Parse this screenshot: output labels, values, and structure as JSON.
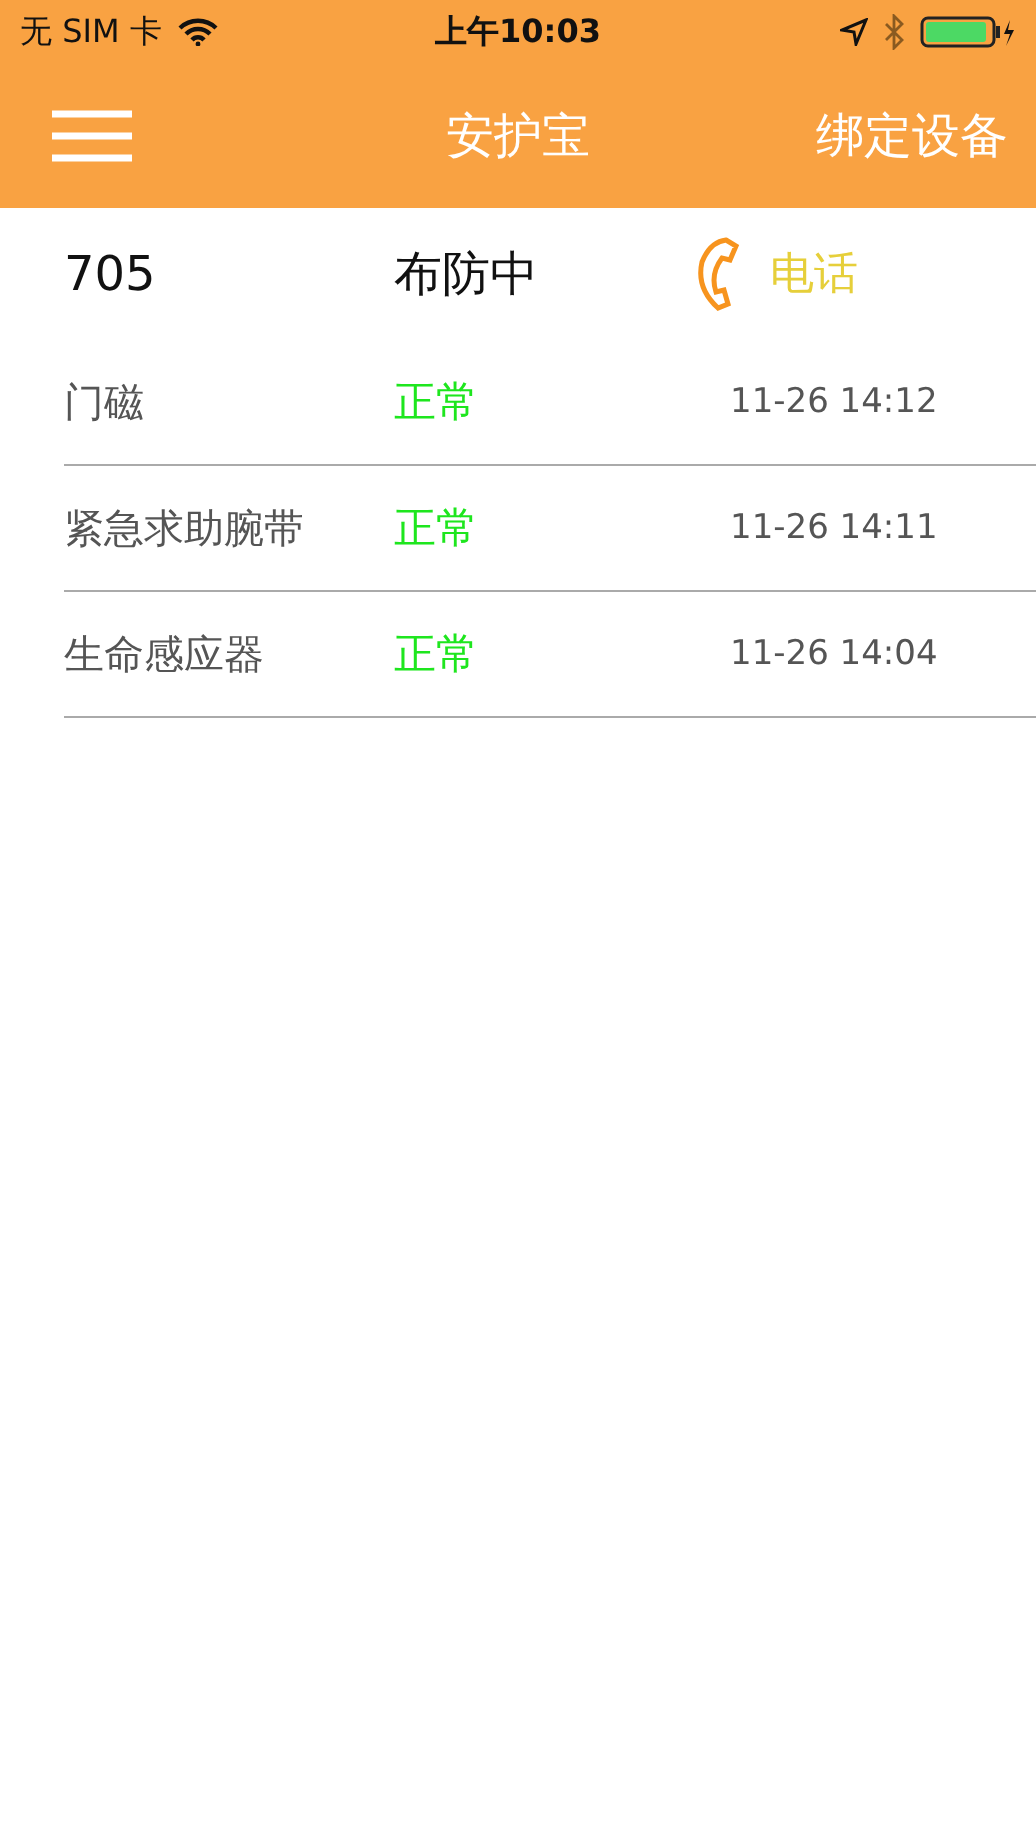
{
  "status_bar": {
    "carrier": "无 SIM 卡",
    "time": "上午10:03"
  },
  "nav_bar": {
    "title": "安护宝",
    "action": "绑定设备"
  },
  "device": {
    "number": "705",
    "state": "布防中",
    "call_label": "电话"
  },
  "sensors": [
    {
      "name": "门磁",
      "status": "正常",
      "time": "11-26 14:12"
    },
    {
      "name": "紧急求助腕带",
      "status": "正常",
      "time": "11-26 14:11"
    },
    {
      "name": "生命感应器",
      "status": "正常",
      "time": "11-26 14:04"
    }
  ]
}
